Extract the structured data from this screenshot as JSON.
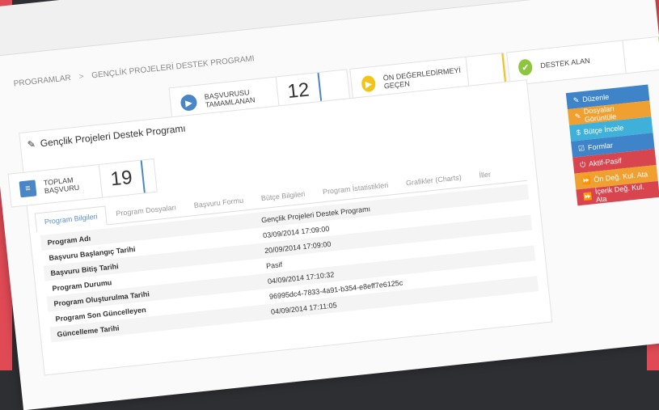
{
  "breadcrumb": [
    "PROGRAMLAR",
    "GENÇLİK PROJELERİ DESTEK PROGRAMI"
  ],
  "stats": [
    {
      "label": "TOPLAM BAŞVURU",
      "value": "19",
      "icon": "list-icon",
      "color": "#4a86c5"
    },
    {
      "label": "BAŞVURUSU TAMAMLANAN",
      "value": "12",
      "icon": "play-icon",
      "color": "#4a86c5"
    },
    {
      "label": "ÖN DEĞERLEDİRMEYİ GEÇEN",
      "value": "",
      "icon": "play-icon",
      "color": "#f0c419"
    },
    {
      "label": "DESTEK ALAN",
      "value": "",
      "icon": "check-icon",
      "color": "#8cc63e"
    }
  ],
  "panel": {
    "title": "Gençlik Projeleri Destek Programı"
  },
  "tabs": [
    "Program Bilgileri",
    "Program Dosyaları",
    "Başvuru Formu",
    "Bütçe Bilgileri",
    "Program İstatistikleri",
    "Grafikler (Charts)",
    "İller"
  ],
  "details": [
    {
      "key": "Program Adı",
      "value": "Gençlik Projeleri Destek Programı"
    },
    {
      "key": "Başvuru Başlangıç Tarihi",
      "value": "03/09/2014 17:09:00"
    },
    {
      "key": "Başvuru Bitiş Tarihi",
      "value": "20/09/2014 17:09:00"
    },
    {
      "key": "Program Durumu",
      "value": "Pasif"
    },
    {
      "key": "Program Oluşturulma Tarihi",
      "value": "04/09/2014 17:10:32"
    },
    {
      "key": "Program Son Güncelleyen",
      "value": "96995dc4-7833-4a91-b354-e8eff7e6125c"
    },
    {
      "key": "Güncelleme Tarihi",
      "value": "04/09/2014 17:11:05"
    }
  ],
  "actions": [
    {
      "label": "Düzenle",
      "color": "#3f84c8",
      "icon": "pencil-icon"
    },
    {
      "label": "Dosyaları Görüntüle",
      "color": "#f0a030",
      "icon": "paperclip-icon"
    },
    {
      "label": "Bütçe İncele",
      "color": "#3fb0d9",
      "icon": "money-icon"
    },
    {
      "label": "Formlar",
      "color": "#3f84c8",
      "icon": "checkbox-icon"
    },
    {
      "label": "Aktif-Pasif",
      "color": "#d9454f",
      "icon": "power-icon"
    },
    {
      "label": "Ön Değ. Kul. Ata",
      "color": "#f0a030",
      "icon": "forward-icon"
    },
    {
      "label": "İçerik Değ. Kul. Ata",
      "color": "#d9454f",
      "icon": "forward-icon"
    }
  ]
}
